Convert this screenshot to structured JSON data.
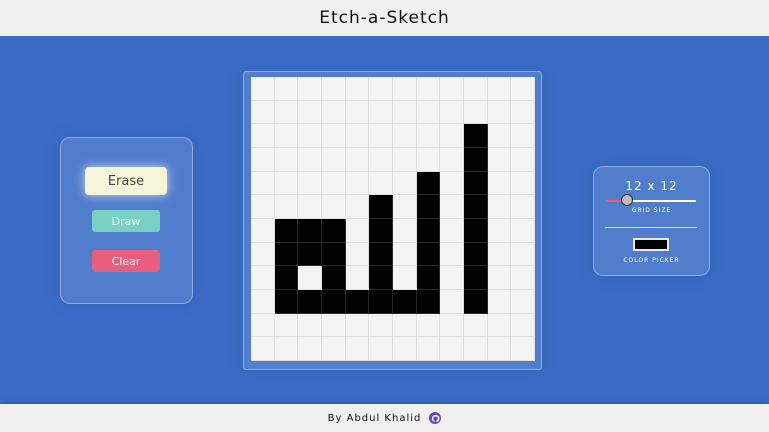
{
  "header": {
    "title": "Etch-a-Sketch"
  },
  "controls": {
    "erase_label": "Erase",
    "draw_label": "Draw",
    "clear_label": "Clear"
  },
  "settings": {
    "grid_size_text": "12 x 12",
    "grid_size_caption": "GRID SIZE",
    "grid_size_value": 12,
    "grid_size_slider_fraction": 0.22,
    "color_picker_caption": "COLOR PICKER",
    "color_value": "#000000"
  },
  "grid": {
    "size": 12,
    "filled_cells": [
      [
        2,
        9
      ],
      [
        3,
        9
      ],
      [
        4,
        7
      ],
      [
        4,
        9
      ],
      [
        5,
        5
      ],
      [
        5,
        7
      ],
      [
        5,
        9
      ],
      [
        6,
        1
      ],
      [
        6,
        2
      ],
      [
        6,
        3
      ],
      [
        6,
        5
      ],
      [
        6,
        7
      ],
      [
        6,
        9
      ],
      [
        7,
        1
      ],
      [
        7,
        2
      ],
      [
        7,
        3
      ],
      [
        7,
        5
      ],
      [
        7,
        7
      ],
      [
        7,
        9
      ],
      [
        8,
        1
      ],
      [
        8,
        3
      ],
      [
        8,
        5
      ],
      [
        8,
        7
      ],
      [
        8,
        9
      ],
      [
        9,
        1
      ],
      [
        9,
        2
      ],
      [
        9,
        3
      ],
      [
        9,
        4
      ],
      [
        9,
        5
      ],
      [
        9,
        6
      ],
      [
        9,
        7
      ],
      [
        9,
        9
      ]
    ]
  },
  "footer": {
    "credit": "By  Abdul  Khalid",
    "icon": "github-icon"
  },
  "colors": {
    "background": "#3a6cc7",
    "erase_button": "#f6f5dc",
    "draw_button": "#77d0c2",
    "clear_button": "#e85e7e",
    "slider_fill": "#e85e7e"
  }
}
